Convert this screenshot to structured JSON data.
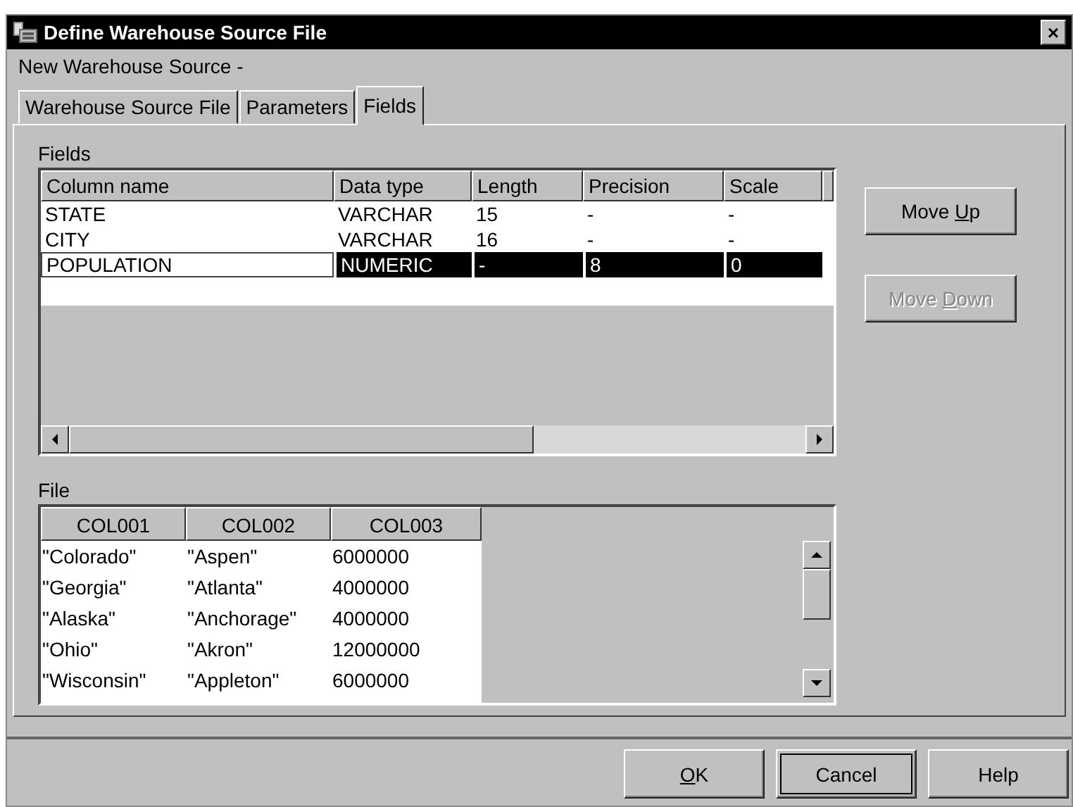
{
  "window": {
    "title": "Define Warehouse Source File",
    "close_label": "×"
  },
  "subtitle": "New Warehouse Source -",
  "tabs": [
    {
      "label": "Warehouse Source File",
      "selected": false
    },
    {
      "label": "Parameters",
      "selected": false
    },
    {
      "label": "Fields",
      "selected": true
    }
  ],
  "fields": {
    "label": "Fields",
    "columns": [
      "Column name",
      "Data type",
      "Length",
      "Precision",
      "Scale"
    ],
    "rows": [
      {
        "cells": [
          "STATE",
          "VARCHAR",
          "15",
          "-",
          "-"
        ],
        "selected": false
      },
      {
        "cells": [
          "CITY",
          "VARCHAR",
          "16",
          "-",
          "-"
        ],
        "selected": false
      },
      {
        "cells": [
          "POPULATION",
          "NUMERIC",
          "-",
          "8",
          "0"
        ],
        "selected": true
      }
    ]
  },
  "side_buttons": [
    {
      "before": "Move ",
      "key": "U",
      "after": "p",
      "disabled": false
    },
    {
      "before": "Move ",
      "key": "D",
      "after": "own",
      "disabled": true
    }
  ],
  "file": {
    "label": "File",
    "columns": [
      "COL001",
      "COL002",
      "COL003"
    ],
    "rows": [
      [
        "\"Colorado\"",
        "\"Aspen\"",
        "6000000"
      ],
      [
        "\"Georgia\"",
        "\"Atlanta\"",
        "4000000"
      ],
      [
        "\"Alaska\"",
        "\"Anchorage\"",
        "4000000"
      ],
      [
        "\"Ohio\"",
        "\"Akron\"",
        "12000000"
      ],
      [
        "\"Wisconsin\"",
        "\"Appleton\"",
        "6000000"
      ]
    ]
  },
  "buttons": [
    {
      "key": "O",
      "after": "K",
      "default": false
    },
    {
      "before": "Cancel",
      "default": true
    },
    {
      "before": "Help",
      "default": false
    }
  ]
}
